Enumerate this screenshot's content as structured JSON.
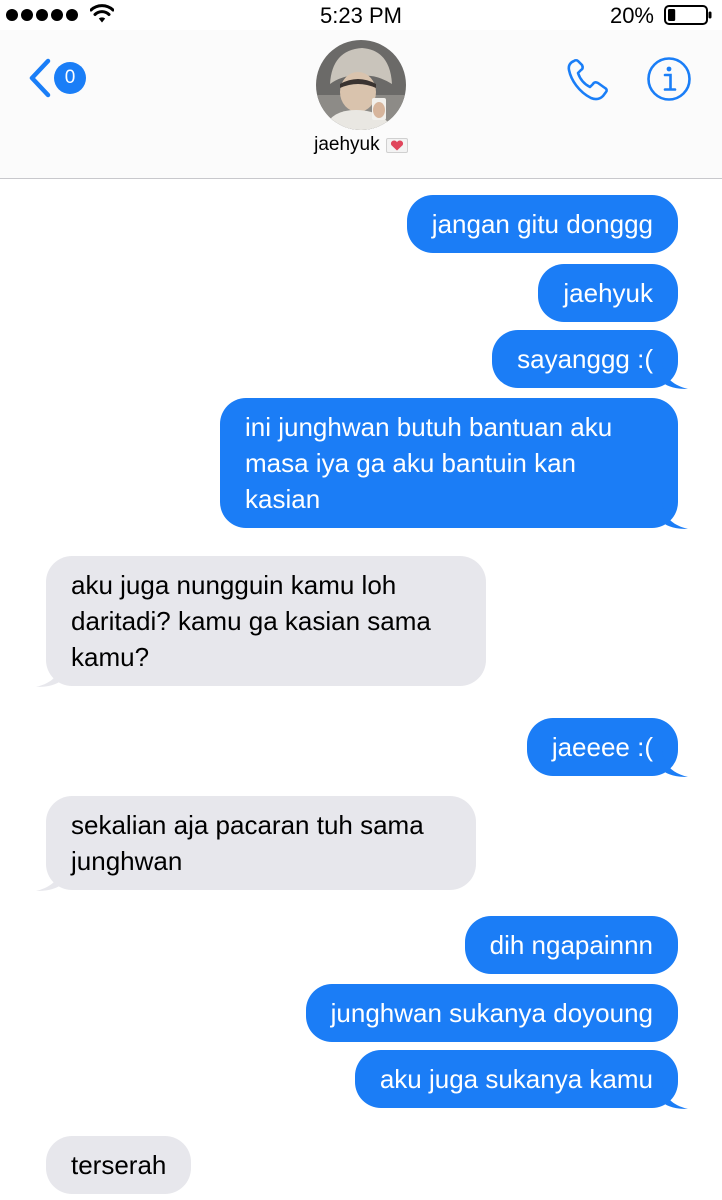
{
  "status_bar": {
    "time": "5:23 PM",
    "battery_percent": "20%",
    "battery_level": 0.2,
    "signal_bars": 5,
    "icons": [
      "signal-dots-icon",
      "wifi-icon",
      "battery-icon"
    ]
  },
  "header": {
    "back_badge_count": "0",
    "contact_name": "jaehyuk",
    "contact_emoji": "heart-emoji",
    "icons": [
      "back-chevron-icon",
      "phone-icon",
      "info-icon"
    ]
  },
  "colors": {
    "sent_bubble": "#1b7df6",
    "received_bubble": "#e7e7ec",
    "accent": "#1a7ef7"
  },
  "messages": [
    {
      "from": "me",
      "text": "jangan gitu donggg"
    },
    {
      "from": "me",
      "text": "jaehyuk"
    },
    {
      "from": "me",
      "text": "sayanggg :("
    },
    {
      "from": "me",
      "text": "ini junghwan butuh bantuan aku masa iya ga aku bantuin kan kasian"
    },
    {
      "from": "them",
      "text": "aku juga nungguin kamu loh daritadi? kamu ga kasian sama kamu?"
    },
    {
      "from": "me",
      "text": "jaeeee :("
    },
    {
      "from": "them",
      "text": "sekalian aja pacaran tuh sama junghwan"
    },
    {
      "from": "me",
      "text": "dih ngapainnn"
    },
    {
      "from": "me",
      "text": "junghwan sukanya doyoung"
    },
    {
      "from": "me",
      "text": "aku juga sukanya kamu"
    },
    {
      "from": "them",
      "text": "terserah"
    }
  ]
}
